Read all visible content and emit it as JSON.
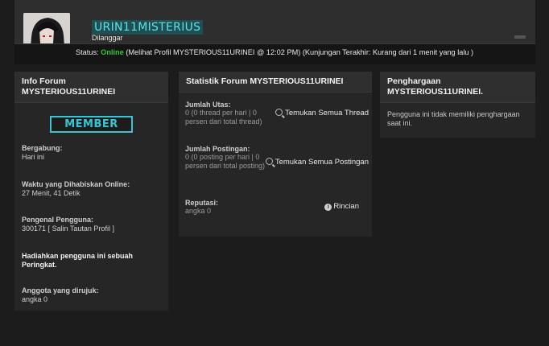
{
  "profile": {
    "username": "URIN11MISTERIUS",
    "usertitle": "Dilanggar",
    "status_label": "Status:",
    "status_value": "Online",
    "status_detail": "(Melihat Profil MYSTERIOUS11URINEI @ 12:02 PM) (Kunjungan Terakhir: Kurang dari 1 menit yang lalu )"
  },
  "info": {
    "title": "Info Forum MYSTERIOUS11URINEI",
    "badge": "MEMBER",
    "joined_label": "Bergabung:",
    "joined_value": "Hari ini",
    "online_label": "Waktu yang Dihabiskan Online:",
    "online_value": "27 Menit, 41 Detik",
    "uid_label": "Pengenal Pengguna:",
    "uid_value": "300171",
    "uid_link": "[ Salin Tautan Profil ]",
    "rank_text": "Hadiahkan pengguna ini sebuah Peringkat.",
    "referred_label": "Anggota yang dirujuk:",
    "referred_value": "angka 0"
  },
  "stats": {
    "title": "Statistik Forum MYSTERIOUS11URINEI",
    "threads_label": "Jumlah Utas:",
    "threads_desc": "0 (0 thread per hari | 0 persen dari total thread)",
    "threads_link": "Temukan Semua Thread",
    "posts_label": "Jumlah Postingan:",
    "posts_desc": "0 (0 posting per hari | 0 persen dari total posting)",
    "posts_link": "Temukan Semua Postingan",
    "rep_label": "Reputasi:",
    "rep_value": "angka 0",
    "rep_link": "Rincian"
  },
  "awards": {
    "title": "Penghargaan MYSTERIOUS11URINEI.",
    "text": "Pengguna ini tidak memiliki penghargaan saat ini."
  },
  "colors": {
    "accent": "#3ac5d3",
    "online": "#36c636",
    "background": "#1c1c1c",
    "panel": "#262626"
  }
}
